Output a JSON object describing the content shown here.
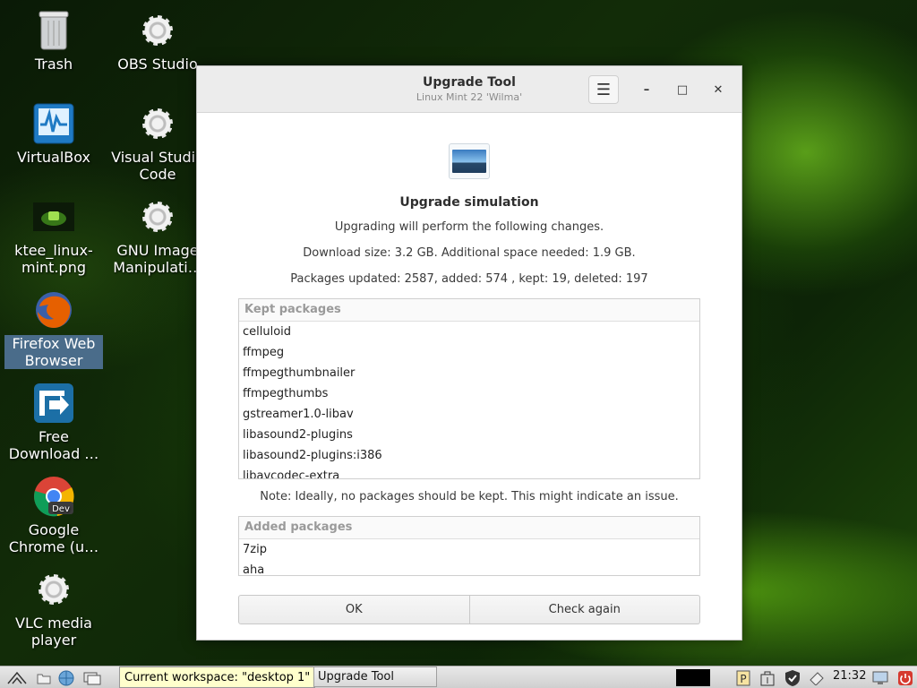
{
  "desktop": {
    "icons": [
      {
        "label": "Trash",
        "icon": "trash-icon"
      },
      {
        "label": "OBS Studio",
        "icon": "gear-icon"
      },
      {
        "label": "VirtualBox",
        "icon": "virtualbox-icon"
      },
      {
        "label": "Visual Studio Code",
        "icon": "gear-icon"
      },
      {
        "label": "ktee_linux-mint.png",
        "icon": "image-file-icon"
      },
      {
        "label": "GNU Image Manipulati…",
        "icon": "gear-icon"
      },
      {
        "label": "Firefox Web Browser",
        "icon": "firefox-icon"
      },
      {
        "label": "Free Download …",
        "icon": "download-manager-icon"
      },
      {
        "label": "Google Chrome (u…",
        "icon": "chrome-dev-icon"
      },
      {
        "label": "VLC media player",
        "icon": "gear-icon"
      }
    ]
  },
  "window": {
    "title": "Upgrade Tool",
    "subtitle": "Linux Mint 22 'Wilma'",
    "menu_icon": "hamburger-menu-icon",
    "minimize": "–",
    "maximize": "□",
    "close": "✕"
  },
  "content": {
    "heading": "Upgrade simulation",
    "intro": "Upgrading will perform the following changes.",
    "download": "Download size: 3.2 GB. Additional space needed: 1.9 GB.",
    "packages_summary": "Packages updated: 2587, added: 574 , kept: 19, deleted: 197",
    "kept": {
      "header": "Kept packages",
      "items": [
        "celluloid",
        "ffmpeg",
        "ffmpegthumbnailer",
        "ffmpegthumbs",
        "gstreamer1.0-libav",
        "libasound2-plugins",
        "libasound2-plugins:i386",
        "libavcodec-extra"
      ]
    },
    "note": "Note: Ideally, no packages should be kept. This might indicate an issue.",
    "added": {
      "header": "Added packages",
      "items": [
        "7zip",
        "aha"
      ]
    },
    "ok_label": "OK",
    "check_again_label": "Check again"
  },
  "taskbar": {
    "tooltip": "Current workspace: \"desktop 1\"",
    "task_label": "Upgrade Tool",
    "clock": "21:32"
  }
}
